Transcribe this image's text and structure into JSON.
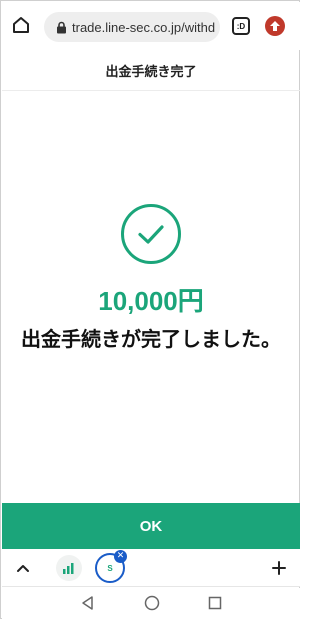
{
  "browser": {
    "url": "trade.line-sec.co.jp/withd",
    "tabs_badge": ":D"
  },
  "page": {
    "title": "出金手続き完了",
    "amount": "10,000円",
    "message": "出金手続きが完了しました。",
    "ok_label": "OK"
  },
  "tab_strip": {
    "tab2_badge": "S",
    "close_glyph": "✕"
  },
  "colors": {
    "accent": "#1ba57a",
    "tab_highlight": "#1a5cc8"
  }
}
